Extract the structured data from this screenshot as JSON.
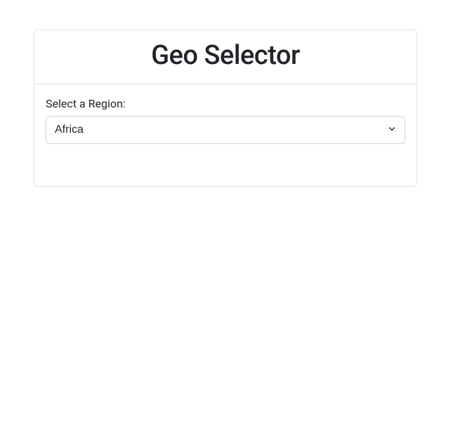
{
  "header": {
    "title": "Geo Selector"
  },
  "form": {
    "region_label": "Select a Region:",
    "region_selected": "Africa"
  }
}
